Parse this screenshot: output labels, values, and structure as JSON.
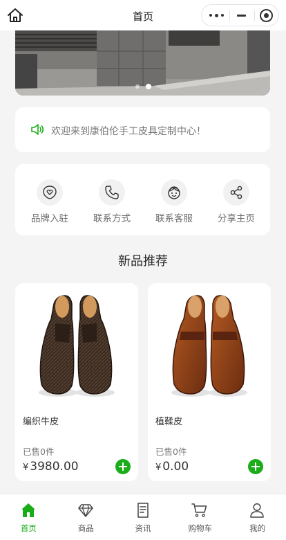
{
  "nav": {
    "title": "首页"
  },
  "notice": {
    "text": "欢迎来到康伯伦手工皮具定制中心！"
  },
  "actions": [
    {
      "label": "品牌入驻",
      "icon": "heart-badge-icon"
    },
    {
      "label": "联系方式",
      "icon": "phone-icon"
    },
    {
      "label": "联系客服",
      "icon": "customer-service-icon"
    },
    {
      "label": "分享主页",
      "icon": "share-icon"
    }
  ],
  "section": {
    "title": "新品推荐"
  },
  "products": [
    {
      "name": "编织牛皮",
      "sold": "已售0件",
      "currency": "¥",
      "price": "3980.00",
      "color": "dark-brown"
    },
    {
      "name": "植鞣皮",
      "sold": "已售0件",
      "currency": "¥",
      "price": "0.00",
      "color": "tan-brown"
    }
  ],
  "tabbar": [
    {
      "label": "首页",
      "icon": "home-icon",
      "active": true
    },
    {
      "label": "商品",
      "icon": "diamond-icon",
      "active": false
    },
    {
      "label": "资讯",
      "icon": "document-icon",
      "active": false
    },
    {
      "label": "购物车",
      "icon": "cart-icon",
      "active": false
    },
    {
      "label": "我的",
      "icon": "user-icon",
      "active": false
    }
  ],
  "colors": {
    "accent": "#1aad19",
    "background": "#f4f4f4"
  }
}
